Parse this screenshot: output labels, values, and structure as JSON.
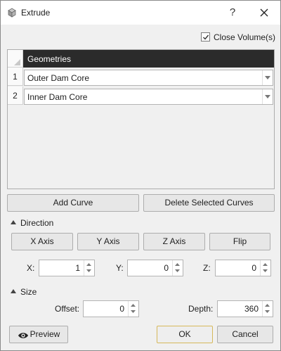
{
  "window": {
    "title": "Extrude",
    "help_glyph": "?",
    "accent_focus": "#d6b85a"
  },
  "close_volume": {
    "label": "Close Volume(s)",
    "checked": true
  },
  "geometries": {
    "header": "Geometries",
    "rows": [
      {
        "num": "1",
        "value": "Outer Dam Core"
      },
      {
        "num": "2",
        "value": "Inner Dam Core"
      }
    ]
  },
  "actions": {
    "add_curve": "Add Curve",
    "delete_selected": "Delete Selected Curves"
  },
  "direction": {
    "heading": "Direction",
    "buttons": {
      "x_axis": "X Axis",
      "y_axis": "Y Axis",
      "z_axis": "Z Axis",
      "flip": "Flip"
    },
    "x": {
      "label": "X:",
      "value": "1"
    },
    "y": {
      "label": "Y:",
      "value": "0"
    },
    "z": {
      "label": "Z:",
      "value": "0"
    }
  },
  "size": {
    "heading": "Size",
    "offset": {
      "label": "Offset:",
      "value": "0"
    },
    "depth": {
      "label": "Depth:",
      "value": "360"
    }
  },
  "footer": {
    "preview": "Preview",
    "ok": "OK",
    "cancel": "Cancel"
  }
}
